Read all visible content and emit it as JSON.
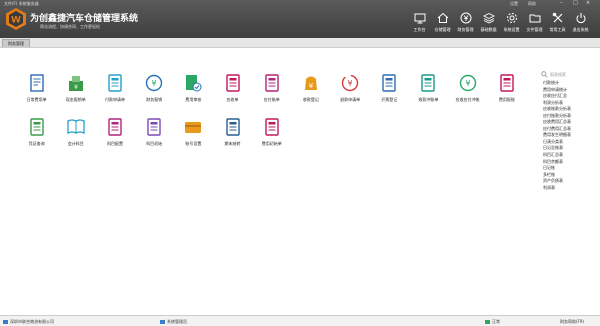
{
  "window": {
    "meta": "文件(F) 系统服务器",
    "user_label": "设置",
    "help_label": "帮助",
    "min": "–",
    "max": "□",
    "close": "×"
  },
  "app": {
    "title": "为创鑫捷汽车仓储管理系统",
    "slogan": "简化流程、协调合同、工作更轻松"
  },
  "toolbar": [
    {
      "label": "工作台",
      "icon": "monitor-icon",
      "name": "toolbar-workbench"
    },
    {
      "label": "仓储管理",
      "icon": "home-icon",
      "name": "toolbar-warehouse"
    },
    {
      "label": "财务管理",
      "icon": "yen-circle-icon",
      "name": "toolbar-finance"
    },
    {
      "label": "基础数据",
      "icon": "layers-icon",
      "name": "toolbar-base-data"
    },
    {
      "label": "系统设置",
      "icon": "settings-icon",
      "name": "toolbar-settings"
    },
    {
      "label": "文件管理",
      "icon": "folder-icon",
      "name": "toolbar-files"
    },
    {
      "label": "常用工具",
      "icon": "tools-icon",
      "name": "toolbar-tools"
    },
    {
      "label": "退出系统",
      "icon": "power-icon",
      "name": "toolbar-exit"
    }
  ],
  "tab": {
    "label": "财务管理"
  },
  "modules": [
    {
      "label": "日常费用单",
      "icon": "receipt-icon",
      "color": "#2d6db5"
    },
    {
      "label": "现金报销单",
      "icon": "cash-box-icon",
      "color": "#3a9a4a"
    },
    {
      "label": "付款申请单",
      "icon": "payment-icon",
      "color": "#27a0c9"
    },
    {
      "label": "财务报销",
      "icon": "exchange-icon",
      "color": "#2a6fb8"
    },
    {
      "label": "费用审核",
      "icon": "approve-icon",
      "color": "#2aa866"
    },
    {
      "label": "应收单",
      "icon": "receivable-icon",
      "color": "#c2185b"
    },
    {
      "label": "应付账单",
      "icon": "payable-icon",
      "color": "#b0247a"
    },
    {
      "label": "收款登记",
      "icon": "wallet-icon",
      "color": "#e89a1b"
    },
    {
      "label": "退款申请单",
      "icon": "refund-icon",
      "color": "#d43a3a"
    },
    {
      "label": "开票登记",
      "icon": "invoice-icon",
      "color": "#2d6db5"
    },
    {
      "label": "收款冲账单",
      "icon": "offset-icon",
      "color": "#1b9a8a"
    },
    {
      "label": "应收应付冲账",
      "icon": "clearing-icon",
      "color": "#2aa866"
    },
    {
      "label": "费用报账",
      "icon": "expense-icon",
      "color": "#c2185b"
    },
    {
      "label": "凭证查询",
      "icon": "voucher-icon",
      "color": "#3a9a4a"
    },
    {
      "label": "会计科目",
      "icon": "book-icon",
      "color": "#27a0c9"
    },
    {
      "label": "科目配置",
      "icon": "config-icon",
      "color": "#b0247a"
    },
    {
      "label": "科目初始",
      "icon": "init-icon",
      "color": "#7a4ab8"
    },
    {
      "label": "账号设置",
      "icon": "card-icon",
      "color": "#e89a1b"
    },
    {
      "label": "期末结转",
      "icon": "period-close-icon",
      "color": "#2a5d8f"
    },
    {
      "label": "费用初始单",
      "icon": "expense-init-icon",
      "color": "#c2185b"
    }
  ],
  "sidebar": {
    "search_placeholder": "报表搜索",
    "items": [
      "付款统计",
      "费用申请统计",
      "应收应付汇总",
      "利润分析表",
      "应收账款分析表",
      "应付账款分析表",
      "应收费用汇总表",
      "应付费用汇总表",
      "费用发生明细表",
      "日清分类表",
      "日记总账表",
      "科目汇总表",
      "科目余额表",
      "日记账",
      "多栏账",
      "资产负债表",
      "利润表"
    ]
  },
  "status": {
    "company": "深圳市联合物流有限公司",
    "login": "系统管理员",
    "state": "正常",
    "help": "财务帮助(F9)"
  }
}
